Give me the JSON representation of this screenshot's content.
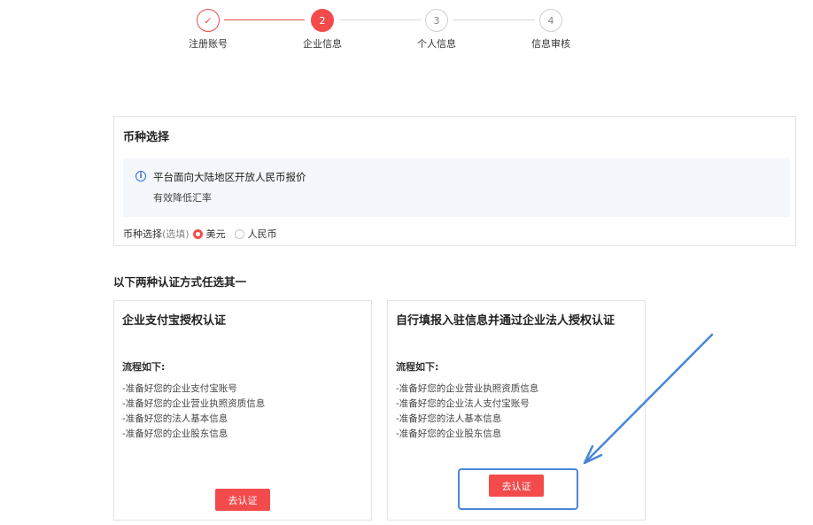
{
  "stepper": {
    "steps": [
      {
        "label": "注册账号",
        "num": "✓",
        "state": "done"
      },
      {
        "label": "企业信息",
        "num": "2",
        "state": "active"
      },
      {
        "label": "个人信息",
        "num": "3",
        "state": "pending"
      },
      {
        "label": "信息审核",
        "num": "4",
        "state": "pending"
      }
    ]
  },
  "currency": {
    "title": "币种选择",
    "notice_icon": "info-circle-icon",
    "notice_line1": "平台面向大陆地区开放人民币报价",
    "notice_line2": "有效降低汇率",
    "field_label": "币种选择",
    "field_hint": "(选填)",
    "options": [
      {
        "label": "美元",
        "selected": true
      },
      {
        "label": "人民币",
        "selected": false
      }
    ]
  },
  "section_title": "以下两种认证方式任选其一",
  "cards": [
    {
      "title": "企业支付宝授权认证",
      "flow_label": "流程如下:",
      "steps": [
        "-准备好您的企业支付宝账号",
        "-准备好您的企业营业执照资质信息",
        "-准备好您的法人基本信息",
        "-准备好您的企业股东信息"
      ],
      "button": "去认证"
    },
    {
      "title": "自行填报入驻信息并通过企业法人授权认证",
      "flow_label": "流程如下:",
      "steps": [
        "-准备好您的企业营业执照资质信息",
        "-准备好您的企业法人支付宝账号",
        "-准备好您的法人基本信息",
        "-准备好您的企业股东信息"
      ],
      "button": "去认证"
    }
  ],
  "colors": {
    "accent": "#f34b4b",
    "annotation": "#4a86d8",
    "info": "#2f6fd6"
  }
}
